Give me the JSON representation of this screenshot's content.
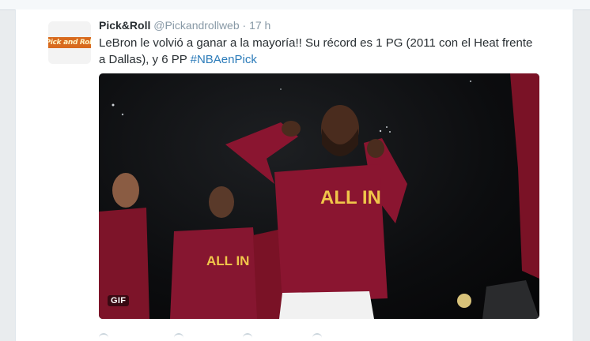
{
  "tweet": {
    "display_name": "Pick&Roll",
    "handle": "@Pickandrollweb",
    "separator": "·",
    "time": "17 h",
    "text_before": "LeBron le volvió a ganar a la mayoría!! Su récord es 1 PG (2011 con el Heat frente a Dallas), y 6 PP ",
    "hashtag": "#NBAenPick",
    "avatar_logo_text": "Pick and Roll",
    "media": {
      "badge": "GIF",
      "jersey_text": "ALL IN"
    }
  },
  "icons": {
    "reply": "reply-icon",
    "retweet": "retweet-icon",
    "like": "heart-icon",
    "more": "more-icon"
  },
  "colors": {
    "link": "#2b7bb9",
    "jersey": "#8a1530",
    "jersey_text": "#f0c64a",
    "muted": "#8899a6"
  }
}
